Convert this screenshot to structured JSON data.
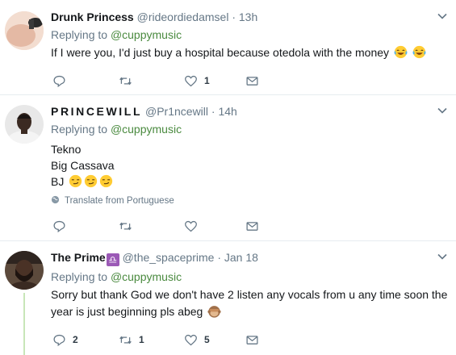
{
  "tweets": [
    {
      "name": "Drunk Princess",
      "handle": "@rideordiedamsel",
      "dot": "·",
      "time": "13h",
      "replying_prefix": "Replying to",
      "replying_to": "@cuppymusic",
      "lines": [
        "If I were you, I'd just buy a hospital because otedola with the money"
      ],
      "emoji": [
        "face-with-tears-of-joy",
        "face-with-tears-of-joy"
      ],
      "counts": {
        "reply": "",
        "retweet": "",
        "like": "1"
      }
    },
    {
      "name": "PRINCEWILL",
      "handle": "@Pr1ncewill",
      "dot": "·",
      "time": "14h",
      "replying_prefix": "Replying to",
      "replying_to": "@cuppymusic",
      "lines": [
        "Tekno",
        "Big Cassava",
        "BJ"
      ],
      "emoji": [
        "smirking-face",
        "smirking-face",
        "smirking-face"
      ],
      "translate": "Translate from Portuguese",
      "counts": {
        "reply": "",
        "retweet": "",
        "like": ""
      }
    },
    {
      "name": "The Prime",
      "handle": "@the_spaceprime",
      "dot": "·",
      "time": "Jan 18",
      "badge": "♎",
      "replying_prefix": "Replying to",
      "replying_to": "@cuppymusic",
      "lines": [
        "Sorry but thank God we don't have 2 listen any vocals from u any time soon the year is just beginning pls abeg"
      ],
      "emoji": [
        "see-no-evil-monkey"
      ],
      "counts": {
        "reply": "2",
        "retweet": "1",
        "like": "5"
      }
    }
  ],
  "colors": {
    "mention": "#4a8a3f",
    "secondary": "#657786",
    "divider": "#e6ecf0",
    "thread": "#c8e6b8"
  }
}
